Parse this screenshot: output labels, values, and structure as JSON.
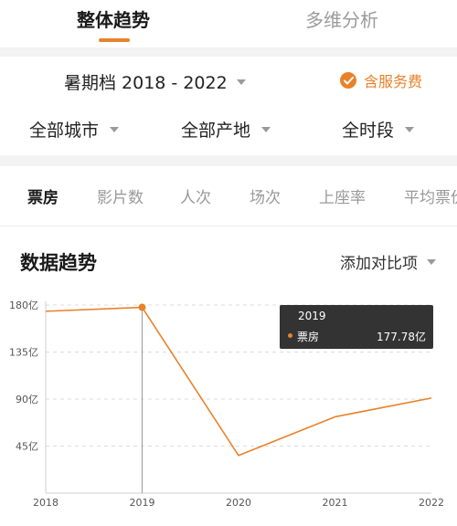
{
  "top_tabs": {
    "overall": "整体趋势",
    "multi": "多维分析"
  },
  "period": {
    "label": "暑期档 2018 - 2022",
    "fee_label": "含服务费"
  },
  "filters": {
    "city": "全部城市",
    "origin": "全部产地",
    "time": "全时段"
  },
  "metric_tabs": [
    "票房",
    "影片数",
    "人次",
    "场次",
    "上座率",
    "平均票价"
  ],
  "chart_section": {
    "title": "数据趋势",
    "compare_label": "添加对比项"
  },
  "tooltip": {
    "year": "2019",
    "metric": "票房",
    "value": "177.78亿"
  },
  "colors": {
    "accent": "#e8822b",
    "tooltip_bg": "#333333"
  },
  "chart_data": {
    "type": "line",
    "x": [
      "2018",
      "2019",
      "2020",
      "2021",
      "2022"
    ],
    "series": [
      {
        "name": "票房",
        "values": [
          174,
          177.78,
          36,
          73,
          91
        ]
      }
    ],
    "ylim": [
      0,
      180
    ],
    "yticks": [
      45,
      90,
      135,
      180
    ],
    "ytick_labels": [
      "45亿",
      "90亿",
      "135亿",
      "180亿"
    ],
    "highlight_index": 1,
    "grid": true
  }
}
